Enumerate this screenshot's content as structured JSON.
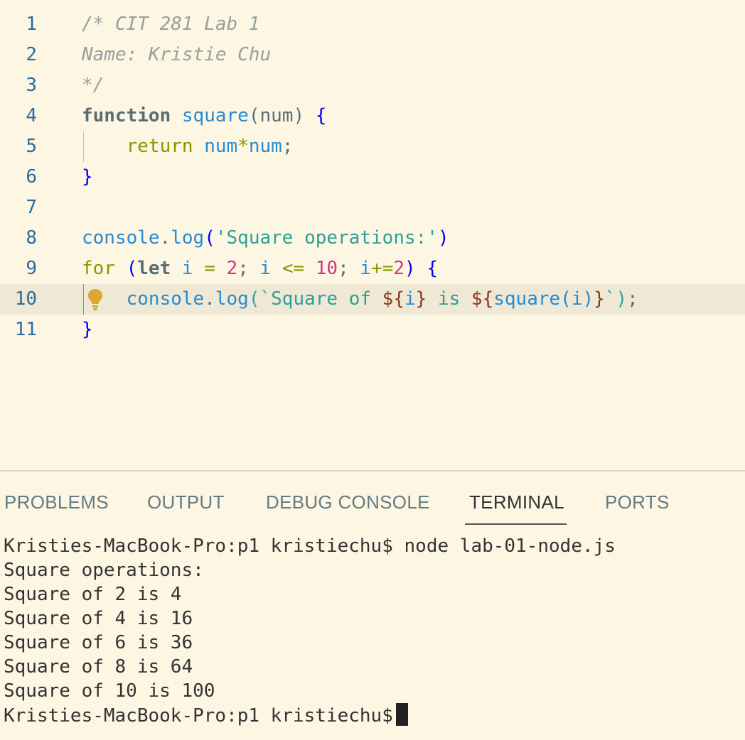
{
  "editor": {
    "line_numbers": [
      "1",
      "2",
      "3",
      "4",
      "5",
      "6",
      "7",
      "8",
      "9",
      "10",
      "11"
    ],
    "lines": {
      "l1": "/* CIT 281 Lab 1",
      "l2": "Name: Kristie Chu",
      "l3": "*/",
      "l4": {
        "kw": "function",
        "name": "square",
        "open": "(",
        "param": "num",
        "close": ")",
        "brace": "{"
      },
      "l5": {
        "kw": "return",
        "a": "num",
        "op": "*",
        "b": "num",
        "semi": ";"
      },
      "l6": "}",
      "l8": {
        "obj": "console",
        "dot": ".",
        "fn": "log",
        "open": "(",
        "str": "'Square operations:'",
        "close": ")"
      },
      "l9": {
        "kw": "for",
        "open": "(",
        "let": "let",
        "i1": "i",
        "eq": "=",
        "n1": "2",
        "s1": ";",
        "i2": "i",
        "le": "<=",
        "n2": "10",
        "s2": ";",
        "i3": "i",
        "pe": "+=",
        "n3": "2",
        "close": ")",
        "brace": "{"
      },
      "l10": {
        "obj": "console",
        "dot": ".",
        "fn": "log",
        "open": "(",
        "tick1": "`Square of ",
        "d1": "${",
        "v1": "i",
        "c1": "}",
        "mid": " is ",
        "d2": "${",
        "f2": "square",
        "o2": "(",
        "v2": "i",
        "cl2": ")",
        "c2": "}",
        "tick2": "`",
        "close": ")",
        "semi": ";"
      },
      "l11": "}"
    },
    "current_line": "10",
    "lightbulb_icon": "lightbulb-icon"
  },
  "panel": {
    "tabs": [
      "PROBLEMS",
      "OUTPUT",
      "DEBUG CONSOLE",
      "TERMINAL",
      "PORTS"
    ],
    "active_tab": "TERMINAL",
    "terminal": {
      "lines": [
        "Kristies-MacBook-Pro:p1 kristiechu$ node lab-01-node.js",
        "Square operations:",
        "Square of 2 is 4",
        "Square of 4 is 16",
        "Square of 6 is 36",
        "Square of 8 is 64",
        "Square of 10 is 100"
      ],
      "prompt": "Kristies-MacBook-Pro:p1 kristiechu$"
    }
  },
  "colors": {
    "background": "#fdf6e3",
    "current_line": "#eee8d5",
    "line_numbers": "#2b6c9d"
  }
}
